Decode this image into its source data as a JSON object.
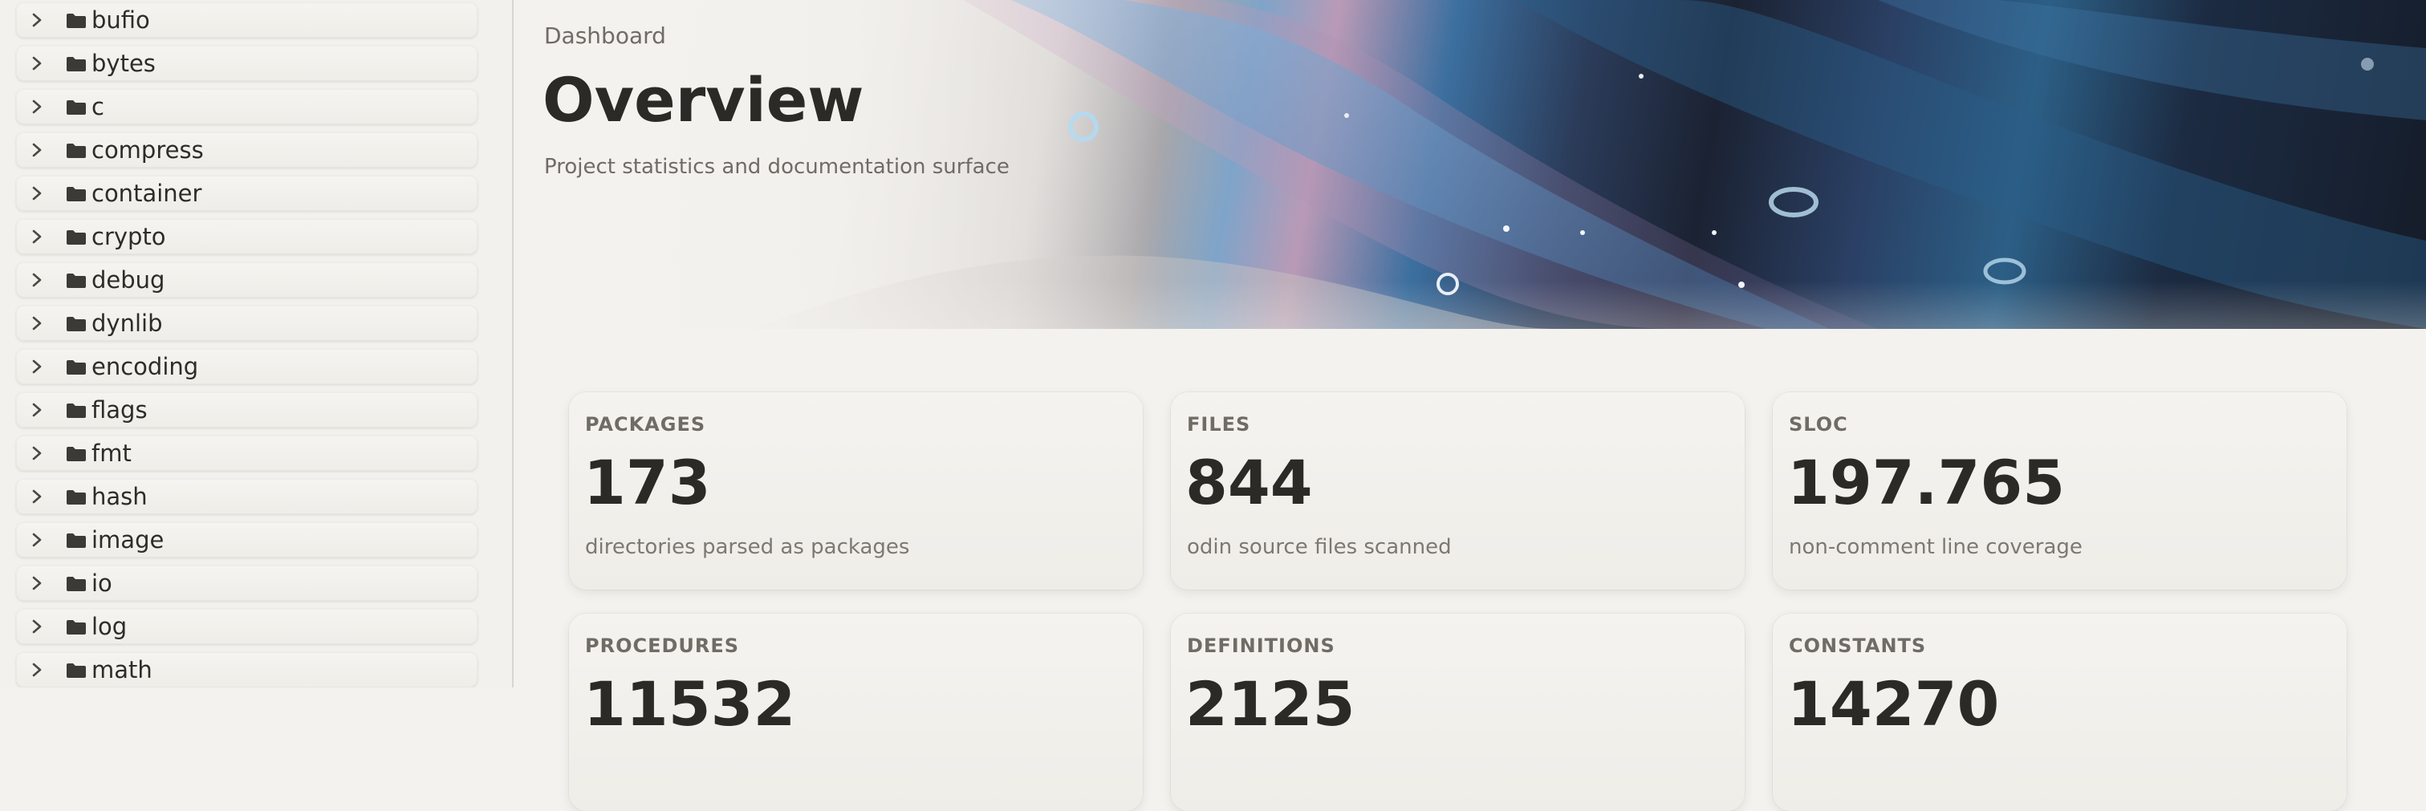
{
  "sidebar": {
    "items": [
      {
        "label": "bufio"
      },
      {
        "label": "bytes"
      },
      {
        "label": "c"
      },
      {
        "label": "compress"
      },
      {
        "label": "container"
      },
      {
        "label": "crypto"
      },
      {
        "label": "debug"
      },
      {
        "label": "dynlib"
      },
      {
        "label": "encoding"
      },
      {
        "label": "flags"
      },
      {
        "label": "fmt"
      },
      {
        "label": "hash"
      },
      {
        "label": "image"
      },
      {
        "label": "io"
      },
      {
        "label": "log"
      },
      {
        "label": "math"
      }
    ]
  },
  "header": {
    "breadcrumb": "Dashboard",
    "title": "Overview",
    "subtitle": "Project statistics and documentation surface"
  },
  "stats": [
    {
      "label": "PACKAGES",
      "value": "173",
      "description": "directories parsed as packages"
    },
    {
      "label": "FILES",
      "value": "844",
      "description": "odin source files scanned"
    },
    {
      "label": "SLOC",
      "value": "197.765",
      "description": "non-comment line coverage"
    },
    {
      "label": "PROCEDURES",
      "value": "11532",
      "description": ""
    },
    {
      "label": "DEFINITIONS",
      "value": "2125",
      "description": ""
    },
    {
      "label": "CONSTANTS",
      "value": "14270",
      "description": ""
    }
  ],
  "icons": {
    "chevron": "chevron-right-icon",
    "folder": "folder-icon"
  },
  "colors": {
    "background": "#f4f2ee",
    "text": "#2b2a27",
    "muted": "#6f6c66"
  }
}
